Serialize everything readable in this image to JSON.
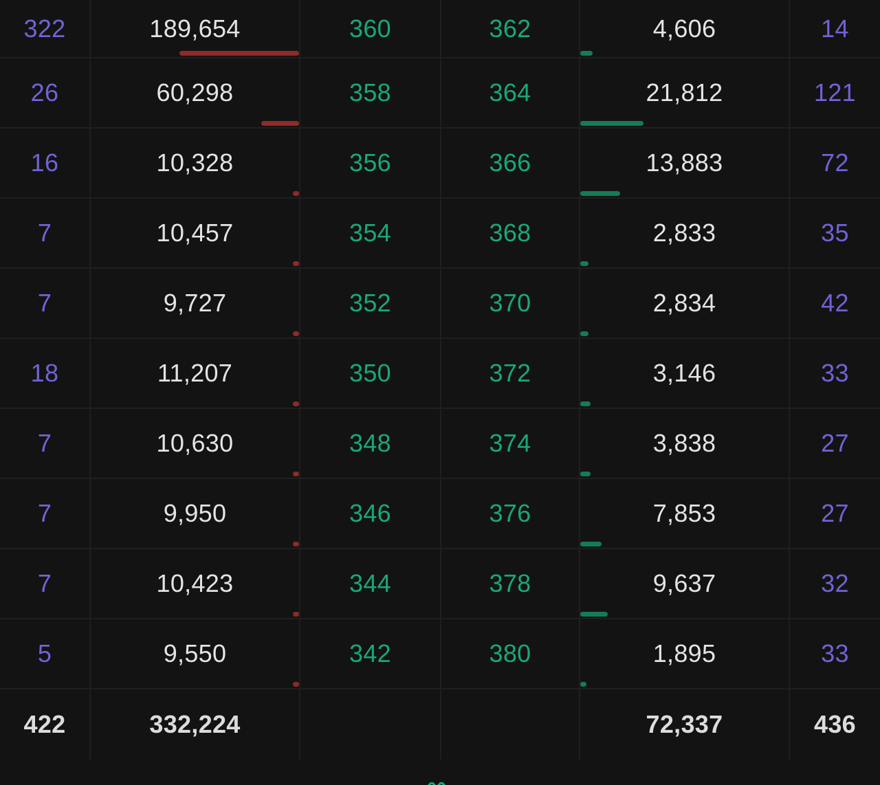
{
  "orderbook": {
    "rows": [
      {
        "bid_count": "322",
        "bid_qty": "189,654",
        "bid_price": "360",
        "ask_price": "362",
        "ask_qty": "4,606",
        "ask_count": "14",
        "bid_depth": 0.57,
        "ask_depth": 0.06
      },
      {
        "bid_count": "26",
        "bid_qty": "60,298",
        "bid_price": "358",
        "ask_price": "364",
        "ask_qty": "21,812",
        "ask_count": "121",
        "bid_depth": 0.18,
        "ask_depth": 0.3
      },
      {
        "bid_count": "16",
        "bid_qty": "10,328",
        "bid_price": "356",
        "ask_price": "366",
        "ask_qty": "13,883",
        "ask_count": "72",
        "bid_depth": 0.03,
        "ask_depth": 0.19
      },
      {
        "bid_count": "7",
        "bid_qty": "10,457",
        "bid_price": "354",
        "ask_price": "368",
        "ask_qty": "2,833",
        "ask_count": "35",
        "bid_depth": 0.03,
        "ask_depth": 0.04
      },
      {
        "bid_count": "7",
        "bid_qty": "9,727",
        "bid_price": "352",
        "ask_price": "370",
        "ask_qty": "2,834",
        "ask_count": "42",
        "bid_depth": 0.03,
        "ask_depth": 0.04
      },
      {
        "bid_count": "18",
        "bid_qty": "11,207",
        "bid_price": "350",
        "ask_price": "372",
        "ask_qty": "3,146",
        "ask_count": "33",
        "bid_depth": 0.03,
        "ask_depth": 0.05
      },
      {
        "bid_count": "7",
        "bid_qty": "10,630",
        "bid_price": "348",
        "ask_price": "374",
        "ask_qty": "3,838",
        "ask_count": "27",
        "bid_depth": 0.03,
        "ask_depth": 0.05
      },
      {
        "bid_count": "7",
        "bid_qty": "9,950",
        "bid_price": "346",
        "ask_price": "376",
        "ask_qty": "7,853",
        "ask_count": "27",
        "bid_depth": 0.03,
        "ask_depth": 0.1
      },
      {
        "bid_count": "7",
        "bid_qty": "10,423",
        "bid_price": "344",
        "ask_price": "378",
        "ask_qty": "9,637",
        "ask_count": "32",
        "bid_depth": 0.03,
        "ask_depth": 0.13
      },
      {
        "bid_count": "5",
        "bid_qty": "9,550",
        "bid_price": "342",
        "ask_price": "380",
        "ask_qty": "1,895",
        "ask_count": "33",
        "bid_depth": 0.03,
        "ask_depth": 0.03
      }
    ],
    "totals": {
      "bid_count": "422",
      "bid_qty": "332,224",
      "ask_qty": "72,337",
      "ask_count": "436"
    }
  },
  "colors": {
    "background": "#131313",
    "count": "#7063d6",
    "quantity": "#e4e4e4",
    "price": "#1aa77a",
    "bid_bar": "#8e2b28",
    "ask_bar": "#147c56"
  },
  "footer": {
    "icon": "chevron-down-icon"
  }
}
